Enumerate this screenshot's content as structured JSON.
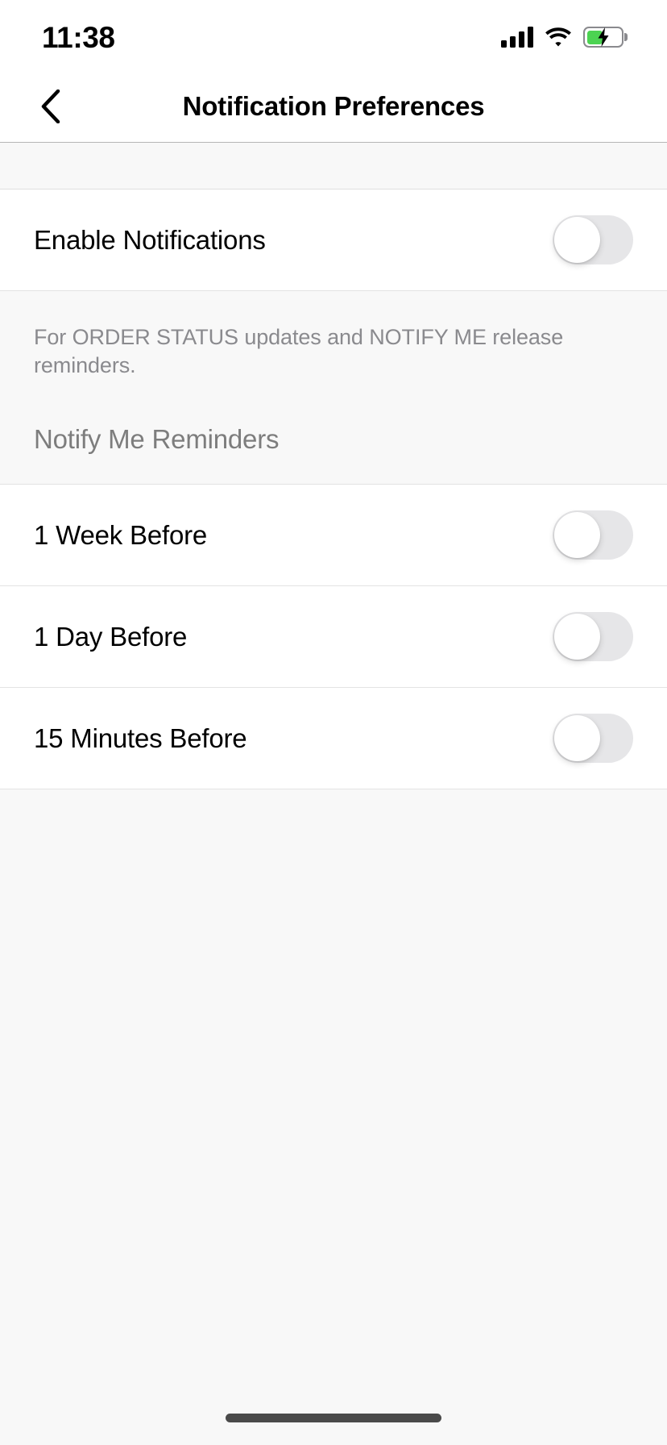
{
  "status_bar": {
    "time": "11:38",
    "cellular_icon": "signal-bars-icon",
    "wifi_icon": "wifi-icon",
    "battery_icon": "battery-charging-icon",
    "battery_level_percent": 48,
    "battery_charging": true,
    "battery_color": "#4CD352"
  },
  "nav_bar": {
    "back_icon": "chevron-left-icon",
    "title": "Notification Preferences"
  },
  "sections": [
    {
      "id": "notifications",
      "header": "",
      "rows": [
        {
          "label": "Enable Notifications",
          "toggle": "off",
          "name": "enable-notifications"
        }
      ],
      "footer": "For ORDER STATUS updates and NOTIFY ME release reminders."
    },
    {
      "id": "notify-me-reminders",
      "header": "Notify Me Reminders",
      "rows": [
        {
          "label": "1 Week Before",
          "toggle": "off",
          "name": "one-week-before"
        },
        {
          "label": "1 Day Before",
          "toggle": "off",
          "name": "one-day-before"
        },
        {
          "label": "15 Minutes Before",
          "toggle": "off",
          "name": "fifteen-minutes-before"
        }
      ],
      "footer": ""
    }
  ],
  "theme": {
    "background": "#F8F8F8",
    "card": "#FFFFFF",
    "separator": "#E3E3E3",
    "text_primary": "#000000",
    "text_secondary": "#8A8A8E",
    "header_text": "#7D7D7D",
    "toggle_off_track": "#E6E6E8",
    "toggle_on_track": "#4CD964",
    "home_indicator": "#4A4A4A"
  },
  "home_indicator": "home-indicator"
}
